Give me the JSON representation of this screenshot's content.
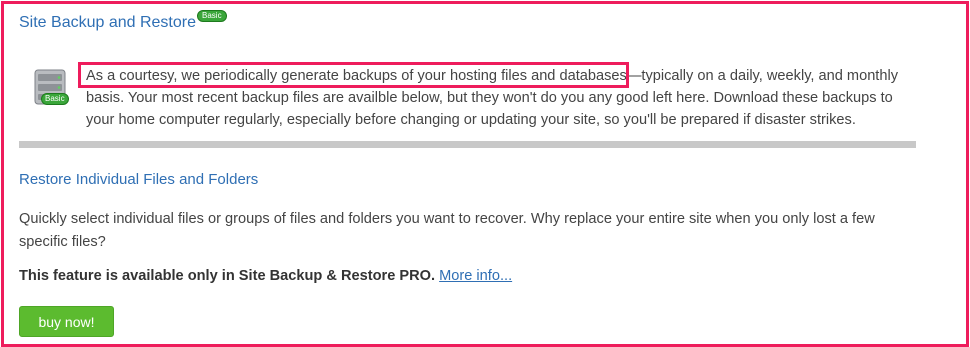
{
  "header": {
    "title": "Site Backup and Restore",
    "badge": "Basic"
  },
  "intro": {
    "highlight": "As a courtesy, we periodically generate backups of your hosting files and databases",
    "rest": "—typically on a daily, weekly, and monthly basis. Your most recent backup files are availble below, but they won't do you any good left here. Download these backups to your home computer regularly, especially before changing or updating your site, so you'll be prepared if disaster strikes.",
    "icon_badge": "Basic",
    "icon": "server-icon"
  },
  "restore": {
    "title": "Restore Individual Files and Folders",
    "description": "Quickly select individual files or groups of files and folders you want to recover. Why replace your entire site when you only lost a few specific files?",
    "feature_text": "This feature is available only in Site Backup & Restore PRO.",
    "more_link": "More info...",
    "buy_button": "buy now!"
  },
  "colors": {
    "accent": "#2f6fb4",
    "highlight_border": "#ee1c5c",
    "badge": "#3aa63a",
    "button": "#5cbb2f"
  }
}
